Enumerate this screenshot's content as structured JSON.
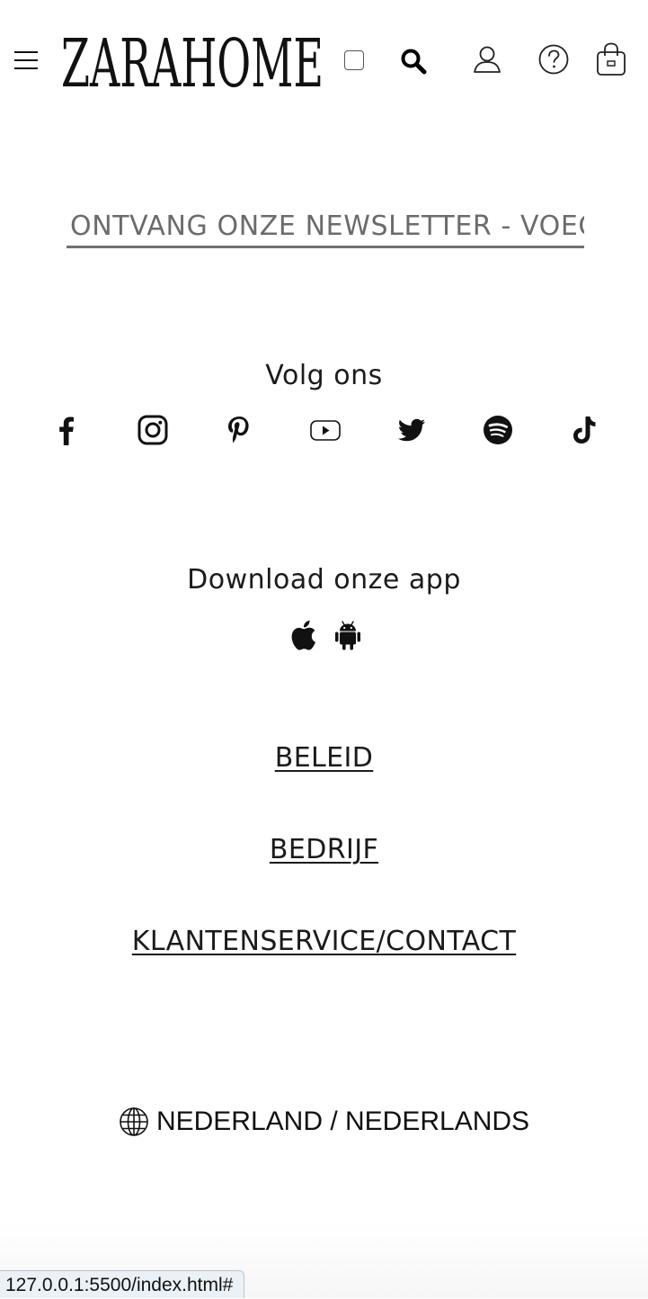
{
  "header": {
    "menu_icon": "hamburger-menu-icon",
    "logo_text": "ZARAHOME",
    "search_icon": "search-icon",
    "account_icon": "user-icon",
    "help_icon": "question-circle-icon",
    "cart_icon": "shopping-bag-icon"
  },
  "newsletter": {
    "label": "ONTVANG ONZE NEWSLETTER - VOEG JE EMAIL TOE"
  },
  "social": {
    "title": "Volg ons",
    "networks": [
      "facebook",
      "instagram",
      "pinterest",
      "youtube",
      "twitter",
      "spotify",
      "tiktok"
    ]
  },
  "app": {
    "title": "Download onze app",
    "platforms": [
      "apple",
      "android"
    ]
  },
  "footer": {
    "links": [
      "BELEID",
      "BEDRIJF",
      "KLANTENSERVICE/CONTACT"
    ]
  },
  "locale": {
    "label": "NEDERLAND / NEDERLANDS",
    "icon": "globe-icon"
  },
  "status_bar": {
    "url": "127.0.0.1:5500/index.html#"
  },
  "colors": {
    "text": "#111111",
    "newsletter_text": "#6b6b6b",
    "status_bar_bg": "#eaf2f7"
  }
}
